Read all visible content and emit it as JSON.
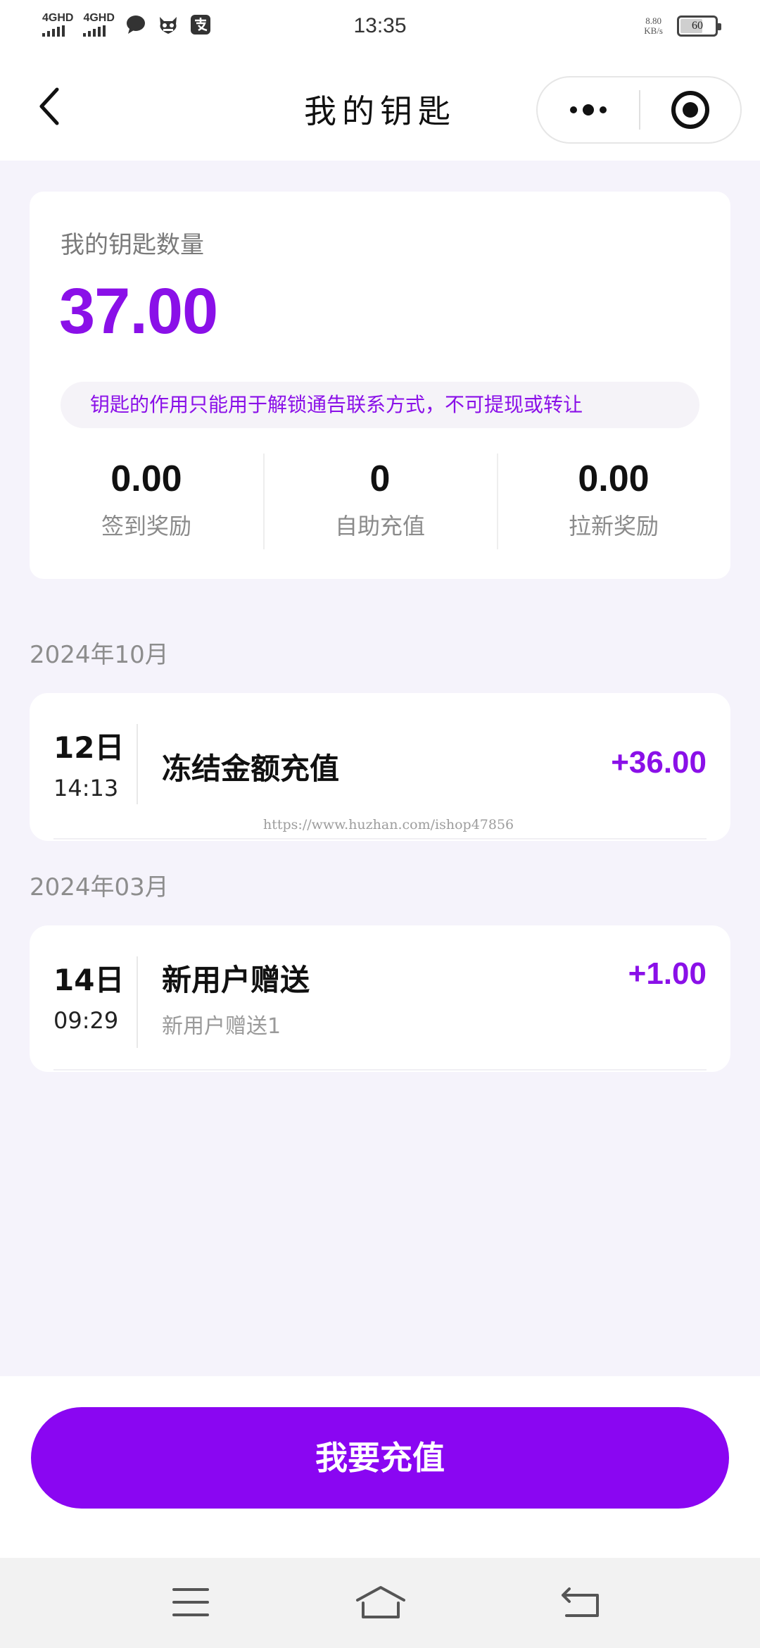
{
  "status_bar": {
    "time": "13:35",
    "signal_1": "4GHD",
    "signal_2": "4GHD",
    "net_speed_value": "8.80",
    "net_speed_unit": "KB/s",
    "battery_level": "60",
    "battery_fraction": 0.6
  },
  "nav": {
    "title": "我的钥匙",
    "back_icon": "chevron-left-icon",
    "more_icon": "more-dots-icon",
    "close_icon": "target-icon"
  },
  "summary": {
    "label": "我的钥匙数量",
    "amount": "37.00",
    "notice": "钥匙的作用只能用于解锁通告联系方式，不可提现或转让",
    "stats": [
      {
        "value": "0.00",
        "label": "签到奖励"
      },
      {
        "value": "0",
        "label": "自助充值"
      },
      {
        "value": "0.00",
        "label": "拉新奖励"
      }
    ]
  },
  "groups": [
    {
      "month": "2024年10月",
      "records": [
        {
          "date": "12日",
          "time": "14:13",
          "title": "冻结金额充值",
          "subtitle": "",
          "amount": "+36.00"
        }
      ]
    },
    {
      "month": "2024年03月",
      "records": [
        {
          "date": "14日",
          "time": "09:29",
          "title": "新用户赠送",
          "subtitle": "新用户赠送1",
          "amount": "+1.00"
        }
      ]
    }
  ],
  "watermark": "https://www.huzhan.com/ishop47856",
  "actions": {
    "recharge_label": "我要充值"
  },
  "system_nav": {
    "menu_icon": "menu-icon",
    "home_icon": "home-icon",
    "back_icon": "back-return-icon"
  },
  "colors": {
    "accent": "#8a10e8",
    "button": "#8a06f2",
    "background": "#f5f3fb"
  }
}
